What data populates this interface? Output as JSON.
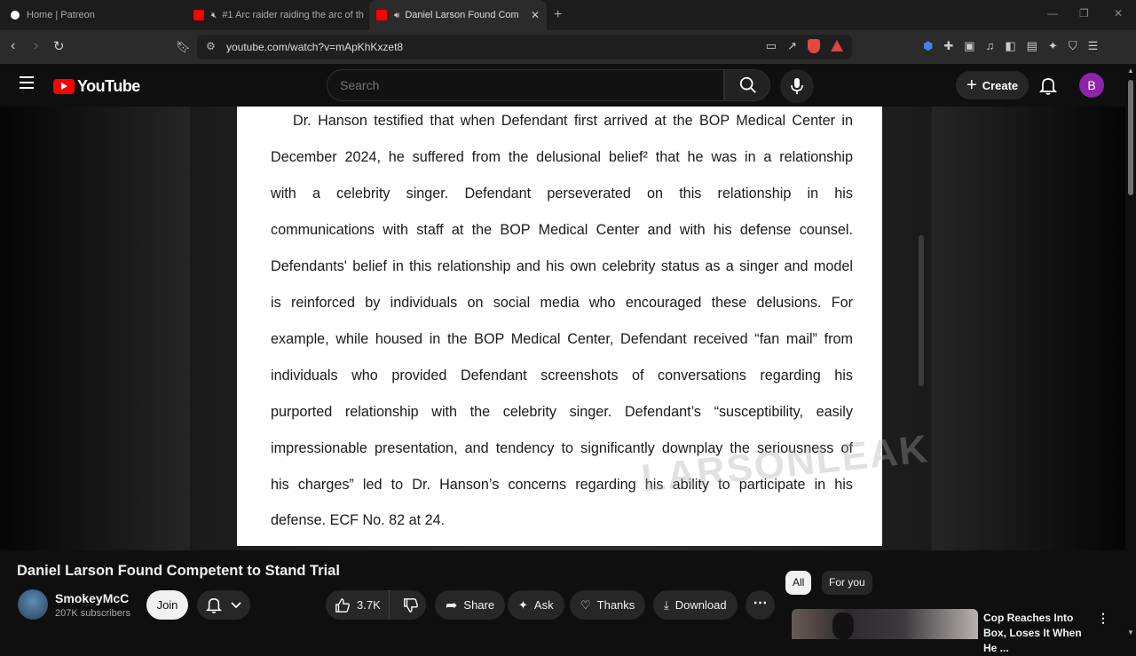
{
  "browser": {
    "tabs": [
      {
        "title": "Home | Patreon",
        "favicon_color": "#ffffff"
      },
      {
        "title": "#1 Arc raider raiding the arc of th",
        "favicon_color": "#ff0000",
        "muted": true
      },
      {
        "title": "Daniel Larson Found Compet",
        "favicon_color": "#ff0000",
        "active": true,
        "audio": true
      }
    ],
    "url": "youtube.com/watch?v=mApKhKxzet8"
  },
  "youtube": {
    "logo_text": "YouTube",
    "search_placeholder": "Search",
    "create_label": "Create",
    "avatar_letter": "B"
  },
  "video": {
    "document_lines": [
      "Dr. Hanson testified that when Defendant first arrived at the BOP Medical Center in",
      "December 2024, he suffered from the delusional belief² that he was in a relationship",
      "with a celebrity singer. Defendant perseverated on this relationship in his",
      "communications with staff at the BOP Medical Center and with his defense counsel.",
      "Defendants' belief in this relationship and his own celebrity status as a singer and model",
      "is reinforced by individuals on social media who encouraged these delusions. For",
      "example, while housed in the BOP Medical Center, Defendant received “fan mail” from",
      "individuals who provided Defendant screenshots of conversations regarding his",
      "purported relationship with the celebrity singer. Defendant’s “susceptibility, easily",
      "impressionable presentation, and tendency to significantly downplay the seriousness of",
      "his charges” led to Dr. Hanson’s concerns regarding his ability to participate in his",
      "defense. ECF No. 82 at 24."
    ],
    "watermark": "LARSONLEAK",
    "title": "Daniel Larson Found Competent to Stand Trial"
  },
  "channel": {
    "name": "SmokeyMcC",
    "subscribers": "207K subscribers",
    "join_label": "Join"
  },
  "actions": {
    "likes": "3.7K",
    "share": "Share",
    "ask": "Ask",
    "thanks": "Thanks",
    "download": "Download"
  },
  "chips": {
    "all": "All",
    "for_you": "For you"
  },
  "recommended": {
    "title": "Cop Reaches Into Box, Loses It When He ..."
  },
  "colors": {
    "yt_red": "#ff0000",
    "avatar": "#8e24aa",
    "background": "#0f0f0f"
  }
}
